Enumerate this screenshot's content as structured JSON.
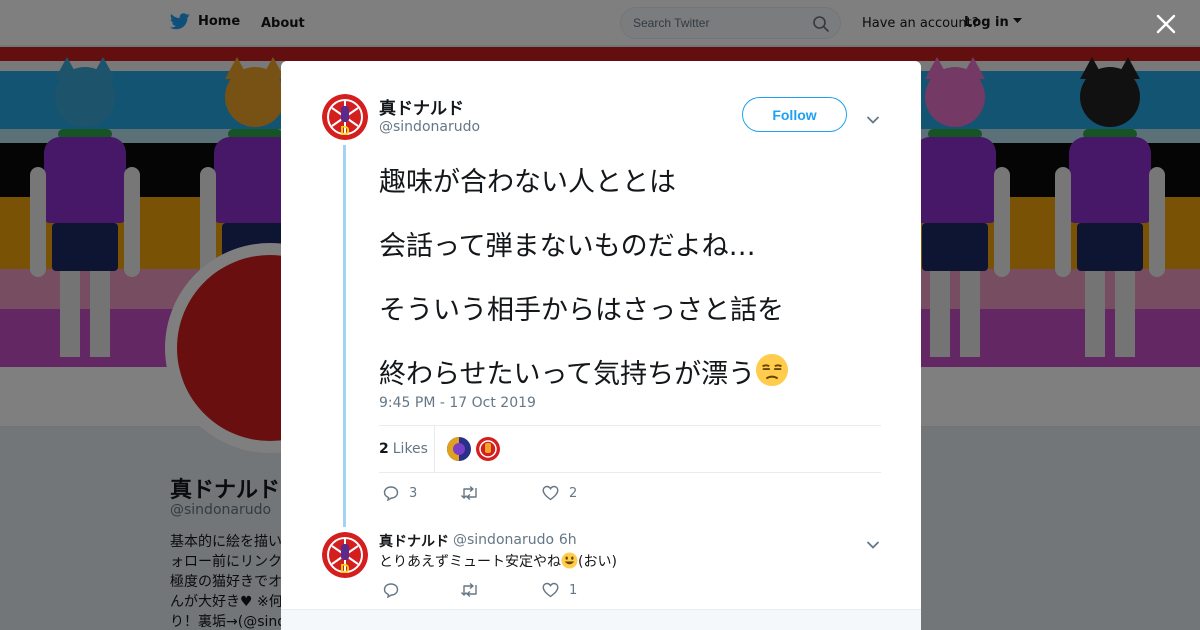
{
  "topbar": {
    "home_label": "Home",
    "about_label": "About",
    "search_placeholder": "Search Twitter",
    "account_prompt": "Have an account?",
    "login_label": "Log in",
    "brand_color": "#1da1f2"
  },
  "profile": {
    "name": "真ドナルド",
    "handle": "@sindonarudo",
    "bio_lines": [
      "基本的に絵を描い",
      "ォロー前にリンク",
      "極度の猫好きでオ",
      "んが大好き♥ ※何",
      "り！裏垢→(@sind"
    ]
  },
  "tweet": {
    "author_name": "真ドナルド",
    "author_handle": "@sindonarudo",
    "follow_label": "Follow",
    "lines": [
      "趣味が合わない人ととは",
      "会話って弾まないものだよね…",
      "そういう相手からはさっさと話を",
      "終わらせたいって気持ちが漂う"
    ],
    "emoji": "unamused-face",
    "timestamp": "9:45 PM - 17 Oct 2019",
    "likes_count": "2",
    "likes_label": "Likes",
    "reply_count": "3",
    "retweet_count": "",
    "like_action_count": "2"
  },
  "reply": {
    "author_name": "真ドナルド",
    "author_handle": "@sindonarudo",
    "time": "· 6h",
    "text_before_emoji": "とりあえずミュート安定やね",
    "emoji": "grinning-face",
    "text_after_emoji": "(おい)",
    "reply_count": "",
    "retweet_count": "",
    "like_count": "1"
  },
  "colors": {
    "accent": "#1da1f2",
    "thread_line": "#a3d3f2",
    "text_primary": "#14171a",
    "text_secondary": "#657786",
    "avatar_red": "#d51e1e"
  }
}
